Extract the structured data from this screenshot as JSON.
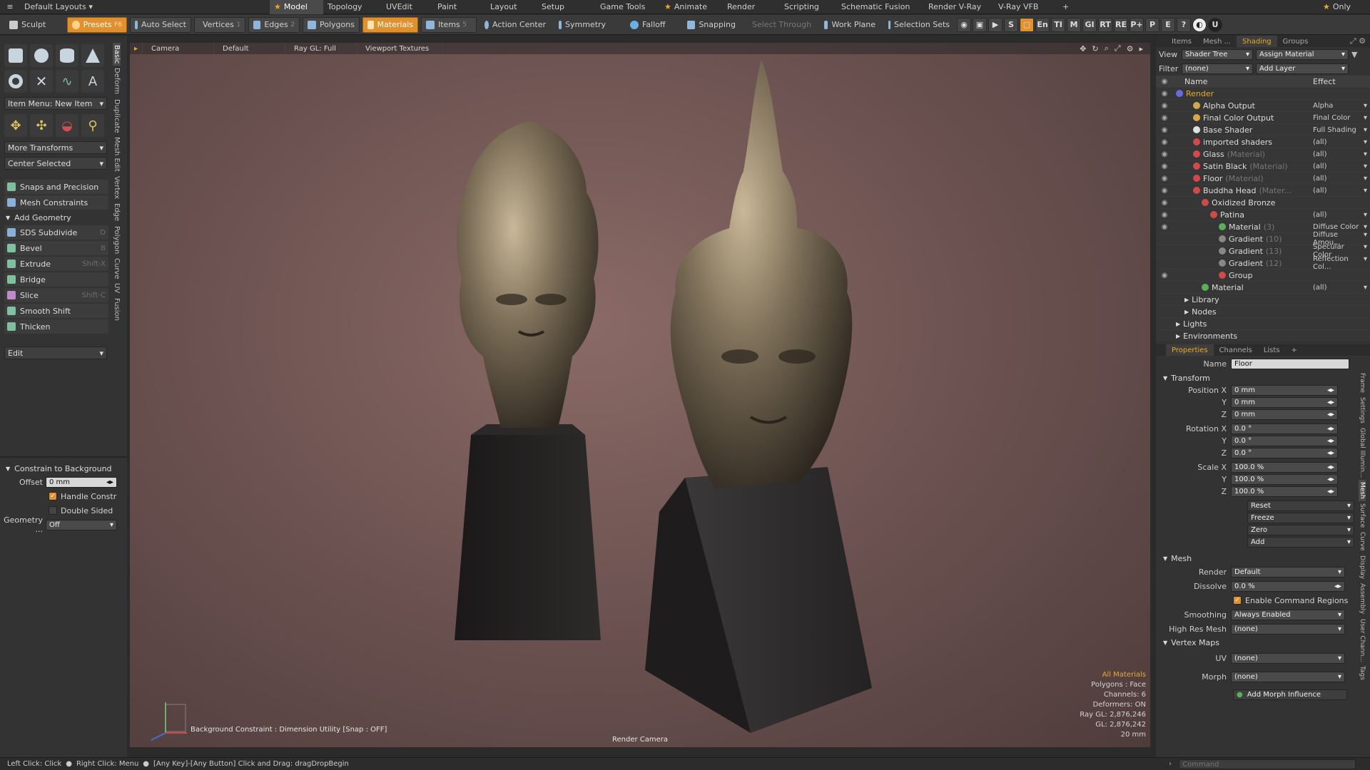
{
  "topbar": {
    "layout": "Default Layouts",
    "tabs": [
      "Model",
      "Topology",
      "UVEdit",
      "Paint",
      "Layout",
      "Setup",
      "Game Tools",
      "Animate",
      "Render",
      "Scripting",
      "Schematic Fusion",
      "Render V-Ray",
      "V-Ray VFB"
    ],
    "active_tab": "Model",
    "only_label": "Only"
  },
  "toolbar": {
    "sculpt": "Sculpt",
    "presets": "Presets",
    "presets_key": "F6",
    "auto_select": "Auto Select",
    "vertices": "Vertices",
    "vertices_num": "1",
    "edges": "Edges",
    "edges_num": "2",
    "polygons": "Polygons",
    "materials": "Materials",
    "items": "Items",
    "items_num": "5",
    "action_center": "Action Center",
    "symmetry": "Symmetry",
    "falloff": "Falloff",
    "snapping": "Snapping",
    "select_through": "Select Through",
    "work_plane": "Work Plane",
    "selection_sets": "Selection Sets",
    "right_icons": [
      "S",
      "En",
      "TI",
      "M",
      "GI",
      "RT",
      "RE",
      "P+",
      "P",
      "E",
      "?"
    ]
  },
  "left": {
    "vtabs": [
      "Basic",
      "Deform",
      "Duplicate",
      "Mesh Edit",
      "Vertex",
      "Edge",
      "Polygon",
      "Curve",
      "UV",
      "Fusion"
    ],
    "item_menu": "Item Menu: New Item",
    "more_transforms": "More Transforms",
    "center_selected": "Center Selected",
    "snaps": "Snaps and Precision",
    "mesh_constraints": "Mesh Constraints",
    "add_geometry": "Add Geometry",
    "tools": [
      {
        "label": "SDS Subdivide",
        "key": "D",
        "color": "#8ab0d8"
      },
      {
        "label": "Bevel",
        "key": "B",
        "color": "#7ec0a0"
      },
      {
        "label": "Extrude",
        "key": "Shift-X",
        "color": "#7ec0a0"
      },
      {
        "label": "Bridge",
        "key": "",
        "color": "#7ec0a0"
      },
      {
        "label": "Slice",
        "key": "Shift-C",
        "color": "#c08ad0"
      },
      {
        "label": "Smooth Shift",
        "key": "",
        "color": "#7ec0a0"
      },
      {
        "label": "Thicken",
        "key": "",
        "color": "#7ec0a0"
      }
    ],
    "edit": "Edit",
    "constrain_title": "Constrain to Background",
    "offset_label": "Offset",
    "offset_value": "0 mm",
    "handle_constr": "Handle Constr",
    "double_sided": "Double Sided",
    "geometry_label": "Geometry ...",
    "geometry_value": "Off"
  },
  "viewport": {
    "tabs": [
      "Camera",
      "Default",
      "Ray GL: Full",
      "Viewport Textures"
    ],
    "constraint_text": "Background Constraint  : Dimension Utility  [Snap : OFF]",
    "camera_label": "Render Camera",
    "info": {
      "title": "All Materials",
      "lines": [
        "Polygons : Face",
        "Channels: 6",
        "Deformers: ON",
        "Ray GL: 2,876,246",
        "GL: 2,876,242",
        "20 mm"
      ]
    }
  },
  "shader": {
    "tabs": [
      "Items",
      "Mesh ...",
      "Shading",
      "Groups"
    ],
    "active": "Shading",
    "view_label": "View",
    "view_value": "Shader Tree",
    "assign": "Assign Material",
    "filter_label": "Filter",
    "filter_value": "(none)",
    "add_layer": "Add Layer",
    "col_name": "Name",
    "col_effect": "Effect",
    "rows": [
      {
        "name": "Render",
        "sub": "",
        "effect": "",
        "indent": 0,
        "color": "#e9a92c",
        "ball": "#6a6ae0",
        "eye": true
      },
      {
        "name": "Alpha Output",
        "sub": "",
        "effect": "Alpha",
        "indent": 2,
        "color": "#ddd",
        "ball": "#d4a84a",
        "eye": true
      },
      {
        "name": "Final Color Output",
        "sub": "",
        "effect": "Final Color",
        "indent": 2,
        "color": "#ddd",
        "ball": "#d4a84a",
        "eye": true
      },
      {
        "name": "Base Shader",
        "sub": "",
        "effect": "Full Shading",
        "indent": 2,
        "color": "#ddd",
        "ball": "#e0e0e0",
        "eye": true
      },
      {
        "name": "imported shaders",
        "sub": "",
        "effect": "(all)",
        "indent": 2,
        "color": "#ddd",
        "ball": "#d04a4a",
        "eye": true
      },
      {
        "name": "Glass",
        "sub": "(Material)",
        "effect": "(all)",
        "indent": 2,
        "color": "#ddd",
        "ball": "#d04a4a",
        "eye": true
      },
      {
        "name": "Satin Black",
        "sub": "(Material)",
        "effect": "(all)",
        "indent": 2,
        "color": "#ddd",
        "ball": "#d04a4a",
        "eye": true
      },
      {
        "name": "Floor",
        "sub": "(Material)",
        "effect": "(all)",
        "indent": 2,
        "color": "#ddd",
        "ball": "#d04a4a",
        "eye": true
      },
      {
        "name": "Buddha Head",
        "sub": "(Mater...",
        "effect": "(all)",
        "indent": 2,
        "color": "#ddd",
        "ball": "#d04a4a",
        "eye": true
      },
      {
        "name": "Oxidized Bronze",
        "sub": "",
        "effect": "",
        "indent": 3,
        "color": "#ddd",
        "ball": "#d04a4a",
        "eye": true
      },
      {
        "name": "Patina",
        "sub": "",
        "effect": "(all)",
        "indent": 4,
        "color": "#ddd",
        "ball": "#d04a4a",
        "eye": true
      },
      {
        "name": "Material",
        "sub": "(3)",
        "effect": "Diffuse Color",
        "indent": 5,
        "color": "#ddd",
        "ball": "#5ab05a",
        "eye": true
      },
      {
        "name": "Gradient",
        "sub": "(10)",
        "effect": "Diffuse Amou...",
        "indent": 5,
        "color": "#ddd",
        "ball": "#888",
        "eye": false
      },
      {
        "name": "Gradient",
        "sub": "(13)",
        "effect": "Specular Color",
        "indent": 5,
        "color": "#ddd",
        "ball": "#888",
        "eye": false
      },
      {
        "name": "Gradient",
        "sub": "(12)",
        "effect": "Reflection Col...",
        "indent": 5,
        "color": "#ddd",
        "ball": "#888",
        "eye": false
      },
      {
        "name": "Group",
        "sub": "",
        "effect": "",
        "indent": 5,
        "color": "#ddd",
        "ball": "#d04a4a",
        "eye": true
      },
      {
        "name": "Material",
        "sub": "",
        "effect": "(all)",
        "indent": 3,
        "color": "#ddd",
        "ball": "#5ab05a",
        "eye": false
      },
      {
        "name": "Library",
        "sub": "",
        "effect": "",
        "indent": 1,
        "color": "#ddd",
        "ball": "",
        "eye": false
      },
      {
        "name": "Nodes",
        "sub": "",
        "effect": "",
        "indent": 1,
        "color": "#ddd",
        "ball": "",
        "eye": false
      },
      {
        "name": "Lights",
        "sub": "",
        "effect": "",
        "indent": 0,
        "color": "#ddd",
        "ball": "",
        "eye": false
      },
      {
        "name": "Environments",
        "sub": "",
        "effect": "",
        "indent": 0,
        "color": "#ddd",
        "ball": "",
        "eye": false
      }
    ]
  },
  "props": {
    "tabs": [
      "Properties",
      "Channels",
      "Lists"
    ],
    "active": "Properties",
    "right_vtabs": [
      "Frame",
      "Settings",
      "Global Illumin...",
      "Mesh",
      "Surface",
      "Curve",
      "Display",
      "Assembly",
      "User Chann...",
      "Tags"
    ],
    "name_label": "Name",
    "name_value": "Floor",
    "transform": "Transform",
    "position_label": "Position X",
    "rotation_label": "Rotation X",
    "scale_label": "Scale X",
    "y": "Y",
    "z": "Z",
    "pos": [
      "0 mm",
      "0 mm",
      "0 mm"
    ],
    "rot": [
      "0.0 °",
      "0.0 °",
      "0.0 °"
    ],
    "scale": [
      "100.0 %",
      "100.0 %",
      "100.0 %"
    ],
    "actions": [
      "Reset",
      "Freeze",
      "Zero",
      "Add"
    ],
    "mesh": "Mesh",
    "render_label": "Render",
    "render_value": "Default",
    "dissolve_label": "Dissolve",
    "dissolve_value": "0.0 %",
    "enable_cmd": "Enable Command Regions",
    "smoothing_label": "Smoothing",
    "smoothing_value": "Always Enabled",
    "hires_label": "High Res Mesh",
    "hires_value": "(none)",
    "vertex_maps": "Vertex Maps",
    "uv_label": "UV",
    "uv_value": "(none)",
    "morph_label": "Morph",
    "morph_value": "(none)",
    "add_morph": "Add Morph Influence"
  },
  "status": {
    "left_click": "Left Click: Click",
    "right_click": "Right Click: Menu",
    "drag": "[Any Key]-[Any Button] Click and Drag: dragDropBegin",
    "command_placeholder": "Command"
  }
}
